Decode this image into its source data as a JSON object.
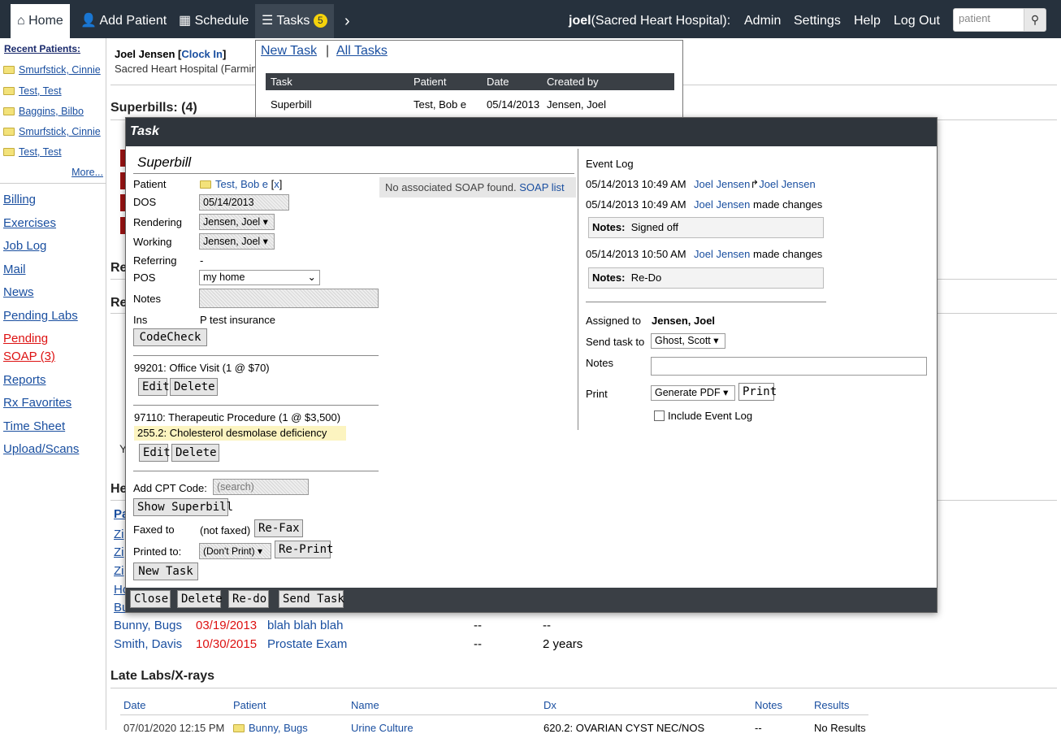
{
  "nav": {
    "home": "Home",
    "add_patient": "Add Patient",
    "schedule": "Schedule",
    "tasks": "Tasks",
    "tasks_count": "5",
    "user": "joel",
    "org": "(Sacred Heart Hospital):",
    "admin": "Admin",
    "settings": "Settings",
    "help": "Help",
    "logout": "Log Out",
    "search_placeholder": "patient"
  },
  "sidebar": {
    "recent_title": "Recent Patients:",
    "recent": [
      "Smurfstick, Cinnie",
      "Test, Test",
      "Baggins, Bilbo",
      "Smurfstick, Cinnie",
      "Test, Test"
    ],
    "more": "More...",
    "links": [
      "Billing",
      "Exercises",
      "Job Log",
      "Mail",
      "News",
      "Pending Labs",
      "Pending SOAP (3)",
      "Reports",
      "Rx Favorites",
      "Time Sheet",
      "Upload/Scans"
    ]
  },
  "page": {
    "user_name": "Joel Jensen",
    "clock_in": "Clock In",
    "facility": "Sacred Heart Hospital (Farmin",
    "superbills_title": "Superbills: (4)",
    "re1": "Re",
    "re2": "Re",
    "he": "He",
    "y": "Y",
    "pa": "Pa",
    "zi": "Zi",
    "ho": "Ho",
    "bu": "Bu",
    "recalls": [
      {
        "patient": "Bunny, Bugs",
        "date": "03/19/2013",
        "desc": "blah blah blah",
        "c1": "--",
        "c2": "--"
      },
      {
        "patient": "Smith, Davis",
        "date": "10/30/2015",
        "desc": "Prostate Exam",
        "c1": "--",
        "c2": "2 years"
      }
    ],
    "late_labs_title": "Late Labs/X-rays",
    "labs_headers": [
      "Date",
      "Patient",
      "Name",
      "Dx",
      "Notes",
      "Results"
    ],
    "labs_row": {
      "date": "07/01/2020 12:15 PM",
      "patient": "Bunny, Bugs",
      "name": "Urine Culture",
      "dx": "620.2: OVARIAN CYST NEC/NOS",
      "notes": "--",
      "results": "No Results"
    }
  },
  "taskpop": {
    "new_task": "New Task",
    "sep": "|",
    "all_tasks": "All Tasks",
    "headers": [
      "Task",
      "Patient",
      "Date",
      "Created by"
    ],
    "row": {
      "task": "Superbill",
      "patient": "Test, Bob e",
      "date": "05/14/2013",
      "created": "Jensen, Joel"
    }
  },
  "modal": {
    "title": "Task",
    "heading": "Superbill",
    "patient_label": "Patient",
    "patient": "Test, Bob e",
    "patient_x": "x",
    "dos_label": "DOS",
    "dos": "05/14/2013",
    "rendering_label": "Rendering",
    "rendering": "Jensen, Joel",
    "working_label": "Working",
    "working": "Jensen, Joel",
    "referring_label": "Referring",
    "referring": "-",
    "pos_label": "POS",
    "pos": "my home",
    "notes_label": "Notes",
    "ins_label": "Ins",
    "ins": "P test insurance",
    "codecheck": "CodeCheck",
    "no_soap": "No associated SOAP found.",
    "soap_list": "SOAP list",
    "proc1": "99201: Office Visit (1 @ $70)",
    "proc2": "97110: Therapeutic Procedure (1 @ $3,500)",
    "dx1": "255.2: Cholesterol desmolase deficiency",
    "edit": "Edit",
    "delete": "Delete",
    "add_cpt_label": "Add CPT Code:",
    "add_cpt_placeholder": "(search)",
    "show_superbill": "Show Superbill",
    "faxed_label": "Faxed to",
    "faxed": "(not faxed)",
    "refax": "Re-Fax",
    "printed_label": "Printed to:",
    "printed": "(Don't Print)",
    "reprint": "Re-Print",
    "new_task": "New Task",
    "event_log_title": "Event Log",
    "events": [
      {
        "time": "05/14/2013 10:49 AM",
        "who": "Joel Jensen",
        "who2": "Joel Jensen"
      },
      {
        "time": "05/14/2013 10:49 AM",
        "who": "Joel Jensen",
        "action": "made changes",
        "notes_label": "Notes:",
        "notes": "Signed off"
      },
      {
        "time": "05/14/2013 10:50 AM",
        "who": "Joel Jensen",
        "action": "made changes",
        "notes_label": "Notes:",
        "notes": "Re-Do"
      }
    ],
    "assigned_label": "Assigned to",
    "assigned": "Jensen, Joel",
    "send_label": "Send task to",
    "send_to": "Ghost, Scott",
    "notes2_label": "Notes",
    "print_label": "Print",
    "print_format": "Generate PDF",
    "print_btn": "Print",
    "include_log": "Include Event Log",
    "close": "Close",
    "delete_btn": "Delete",
    "redo": "Re-do",
    "send_task": "Send Task"
  }
}
